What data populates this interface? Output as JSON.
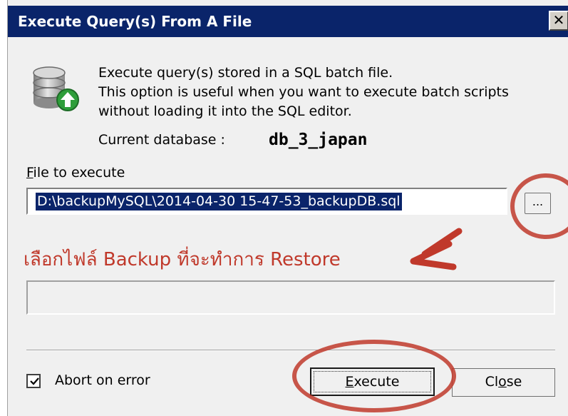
{
  "window": {
    "title": "Execute Query(s) From A File",
    "close_glyph": "✕"
  },
  "description": {
    "line1": "Execute query(s) stored in a SQL batch file.",
    "line2": "This option is useful when you want to execute batch scripts",
    "line3": "without loading it into the SQL editor."
  },
  "current_database": {
    "label": "Current database :",
    "value": "db_3_japan"
  },
  "file": {
    "label_mnemonic": "F",
    "label_rest": "ile to execute",
    "value": "D:\\backupMySQL\\2014-04-30 15-47-53_backupDB.sql",
    "browse_label": "..."
  },
  "annotation": {
    "text": "เลือกไฟล์ Backup ที่จะทำการ Restore",
    "color": "#c0392b"
  },
  "options": {
    "abort_on_error_label": "Abort on error",
    "abort_on_error_checked": true
  },
  "buttons": {
    "execute_mnemonic": "E",
    "execute_rest": "xecute",
    "close_pre": "Cl",
    "close_mnemonic": "o",
    "close_post": "se"
  },
  "colors": {
    "titlebar": "#0a246a",
    "dialog_bg": "#f0f0f0",
    "selection": "#0a246a"
  },
  "icons": {
    "database": "database-upload-icon",
    "close": "close-icon",
    "check": "checkmark-icon"
  }
}
